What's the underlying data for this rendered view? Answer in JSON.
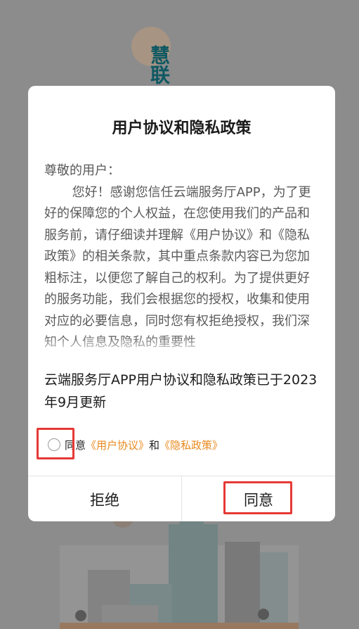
{
  "background": {
    "logo_text": "慧联"
  },
  "dialog": {
    "title": "用户协议和隐私政策",
    "greeting": "尊敬的用户：",
    "body": "您好！感谢您信任云端服务厅APP，为了更好的保障您的个人权益，在您使用我们的产品和服务前，请仔细读并理解《用户协议》和《隐私政策》的相关条款，其中重点条款内容已为您加粗标注，以便您了解自己的权利。为了提供更好的服务功能，我们会根据您的授权，收集和使用对应的必要信息，同时您有权拒绝授权，我们深知个人信息及隐私的重要性",
    "update_note": "云端服务厅APP用户协议和隐私政策已于2023年9月更新",
    "consent": {
      "prefix": "同意",
      "link1": "《用户协议》",
      "and": "和",
      "link2": "《隐私政策》"
    },
    "buttons": {
      "reject": "拒绝",
      "agree": "同意"
    }
  },
  "colors": {
    "link": "#e88a1f",
    "highlight": "#e53935",
    "overlay": "#8c8c8c"
  }
}
